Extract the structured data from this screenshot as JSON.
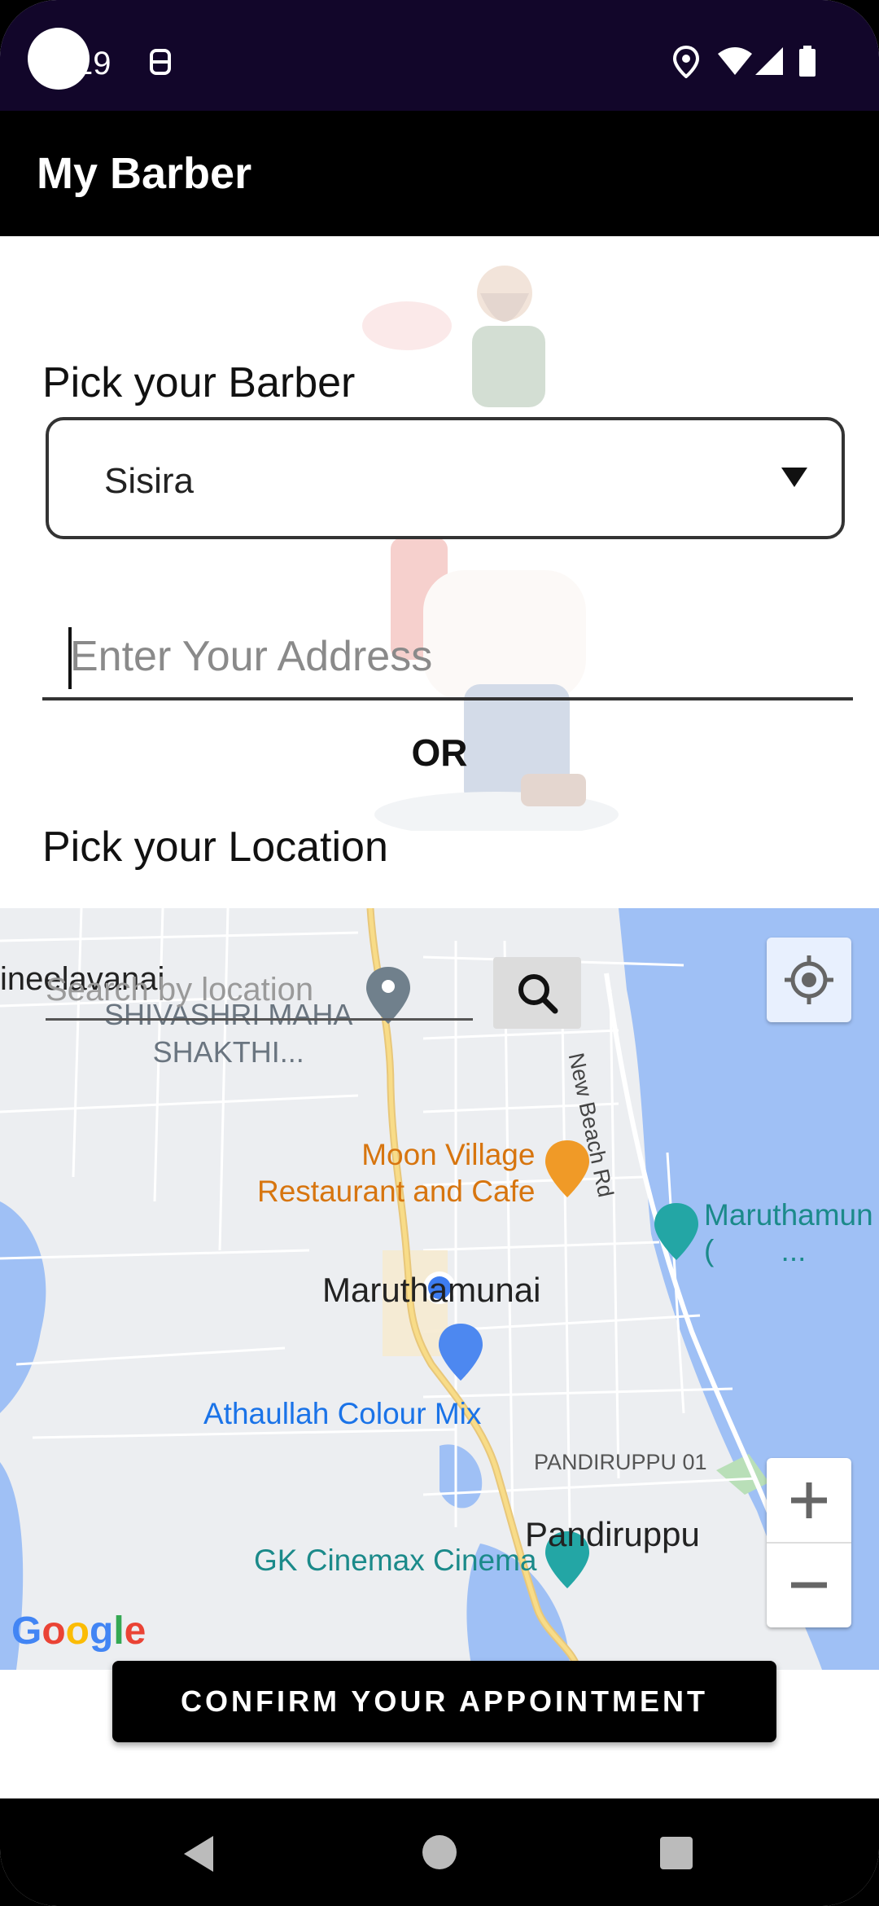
{
  "status_bar": {
    "time": "19"
  },
  "app_bar": {
    "title": "My Barber"
  },
  "barber_section": {
    "label": "Pick your Barber",
    "selected_barber": "Sisira"
  },
  "address": {
    "placeholder": "Enter Your Address"
  },
  "or_text": "OR",
  "location_section": {
    "label": "Pick your Location"
  },
  "map": {
    "search_placeholder": "Search by location",
    "labels": {
      "place_left": "ineelavanai",
      "poi_temple": "SHIVASHRI MAHA\nSHAKTHI...",
      "restaurant": "Moon Village\nRestaurant and Cafe",
      "town": "Maruthamunai",
      "shop": "Athaullah Colour Mix",
      "area": "PANDIRUPPU 01",
      "town2": "Pandiruppu",
      "cinema": "GK Cinemax Cinema",
      "road": "New Beach Rd",
      "beach_poi": "Maruthamun\n(        ..."
    },
    "attribution": "Google"
  },
  "confirm_button": "CONFIRM YOUR APPOINTMENT",
  "colors": {
    "status_bar": "#12062a",
    "app_bar": "#000000",
    "water": "#9fc0f5",
    "map_land": "#eceef1"
  }
}
